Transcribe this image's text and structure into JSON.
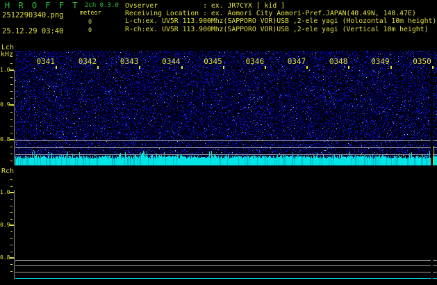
{
  "app": {
    "title": "H R O F F T",
    "version": "2ch 0.3.0",
    "mode": "meteor",
    "filename": "2512290340.png",
    "datetime": "25.12.29 03:40",
    "count_top": "0",
    "count_bottom": "0"
  },
  "info": {
    "lines": [
      "Ovserver           : ex. JR7CYX [ kid ]",
      "Receiving Location : ex. Aomori City Aomori-Pref.JAPAN(40.49N, 140.47E)",
      "L-ch:ex. UV5R 113.900Mhz(SAPPORO VOR)USB ,2-ele yagi (Holozontal 10m height)",
      "R-ch:ex. UV5R 113.900Mhz(SAPPORO VOR)USB ,2-ele yagi (Vertical 10m height)"
    ]
  },
  "lch": {
    "label": "Lch",
    "unit": "kHz",
    "yticks": [
      "1.0",
      "0.9",
      "0.8"
    ],
    "time_labels": [
      "0341",
      "0342",
      "0343",
      "0344",
      "0345",
      "0346",
      "0347",
      "0348",
      "0349",
      "0350"
    ]
  },
  "rch": {
    "label": "Rch",
    "yticks": [
      "1.0",
      "0.9",
      "0.8"
    ]
  },
  "colors": {
    "background": "#000000",
    "title_green": "#2bc437",
    "text_yellow": "#e2e13e",
    "grid_gray": "#a8a8a8",
    "axis_gray": "#8a8a8a",
    "signal_cyan": "#00e6e6",
    "noise_blue": "#0000c8",
    "marker_yellow": "#e8e800"
  }
}
